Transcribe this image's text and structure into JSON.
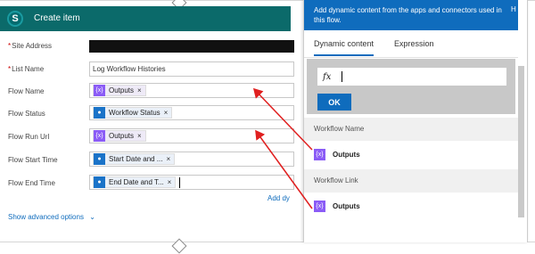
{
  "card": {
    "title": "Create item",
    "logo_letter": "S",
    "fields": [
      {
        "label": "Site Address",
        "required": true
      },
      {
        "label": "List Name",
        "required": true,
        "value": "Log Workflow Histories"
      },
      {
        "label": "Flow Name",
        "token": "Outputs"
      },
      {
        "label": "Flow Status",
        "token": "Workflow Status"
      },
      {
        "label": "Flow Run Url",
        "token": "Outputs"
      },
      {
        "label": "Flow Start Time",
        "token": "Start Date and ..."
      },
      {
        "label": "Flow End Time",
        "token": "End Date and T..."
      }
    ],
    "required_mark": "*",
    "close_glyph": "×",
    "add_dynamic": "Add dy",
    "show_advanced": "Show advanced options"
  },
  "panel": {
    "banner": "Add dynamic content from the apps and connectors used in this flow.",
    "banner_edge": "H",
    "tabs": [
      "Dynamic content",
      "Expression"
    ],
    "fx": "fx",
    "ok_label": "OK",
    "sections": [
      {
        "header": "Workflow Name",
        "item": "Outputs"
      },
      {
        "header": "Workflow Link",
        "item": "Outputs"
      }
    ]
  },
  "icons": {
    "expression": "expression-icon",
    "person": "person-icon",
    "chevron": "chevron-down-icon"
  },
  "colors": {
    "header_teal": "#0b6a6a",
    "accent_blue": "#0f6cbd",
    "token_purple": "#8b5cf6",
    "arrow_red": "#e02020"
  }
}
